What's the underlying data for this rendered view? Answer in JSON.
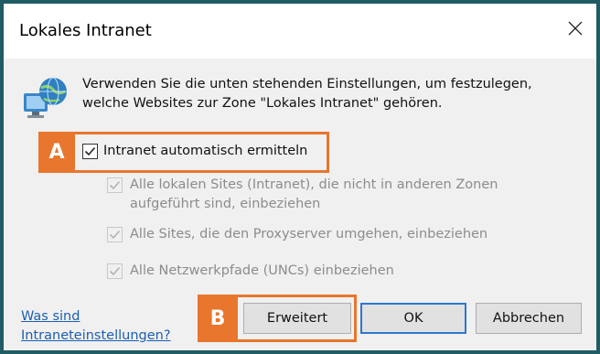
{
  "dialog": {
    "title": "Lokales Intranet",
    "close_icon": "close-icon",
    "intro_text": "Verwenden Sie die unten stehenden Einstellungen, um festzulegen, welche Websites zur Zone \"Lokales Intranet\" gehören.",
    "icon": "globe-computer-icon"
  },
  "options": {
    "auto_detect": {
      "label": "Intranet automatisch ermitteln",
      "checked": true,
      "enabled": true
    },
    "local_sites": {
      "label": "Alle lokalen Sites (Intranet), die nicht in anderen Zonen aufgeführt sind, einbeziehen",
      "checked": true,
      "enabled": false
    },
    "proxy_bypass": {
      "label": "Alle Sites, die den Proxyserver umgehen, einbeziehen",
      "checked": true,
      "enabled": false
    },
    "unc_paths": {
      "label": "Alle Netzwerkpfade (UNCs) einbeziehen",
      "checked": true,
      "enabled": false
    }
  },
  "footer": {
    "help_link": "Was sind Intraneteinstellungen?",
    "advanced_button": "Erweitert",
    "ok_button": "OK",
    "cancel_button": "Abbrechen"
  },
  "annotations": {
    "badge_a": "A",
    "badge_b": "B",
    "highlight_color": "#e8762d"
  },
  "colors": {
    "accent": "#2b78d0",
    "link": "#1d5fb0",
    "disabled_text": "#8c8c8c",
    "background": "#f0f0f0"
  }
}
